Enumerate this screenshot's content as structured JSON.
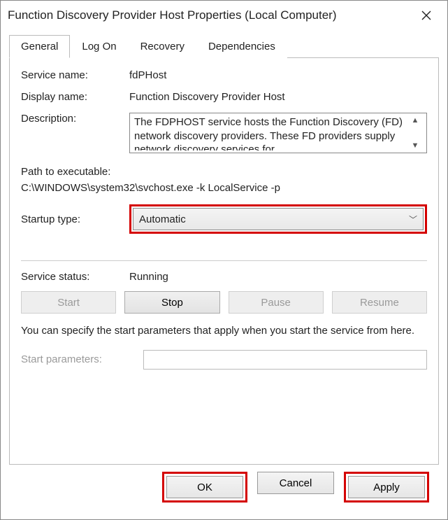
{
  "window": {
    "title": "Function Discovery Provider Host Properties (Local Computer)"
  },
  "tabs": {
    "general": "General",
    "logon": "Log On",
    "recovery": "Recovery",
    "dependencies": "Dependencies"
  },
  "labels": {
    "service_name": "Service name:",
    "display_name": "Display name:",
    "description": "Description:",
    "path_label": "Path to executable:",
    "startup_type": "Startup type:",
    "service_status": "Service status:",
    "start_params": "Start parameters:"
  },
  "values": {
    "service_name": "fdPHost",
    "display_name": "Function Discovery Provider Host",
    "description": "The FDPHOST service hosts the Function Discovery (FD) network discovery providers. These FD providers supply network discovery services for",
    "path": "C:\\WINDOWS\\system32\\svchost.exe -k LocalService -p",
    "startup_type": "Automatic",
    "service_status": "Running",
    "start_params": ""
  },
  "buttons": {
    "start": "Start",
    "stop": "Stop",
    "pause": "Pause",
    "resume": "Resume",
    "ok": "OK",
    "cancel": "Cancel",
    "apply": "Apply"
  },
  "hint": "You can specify the start parameters that apply when you start the service from here."
}
